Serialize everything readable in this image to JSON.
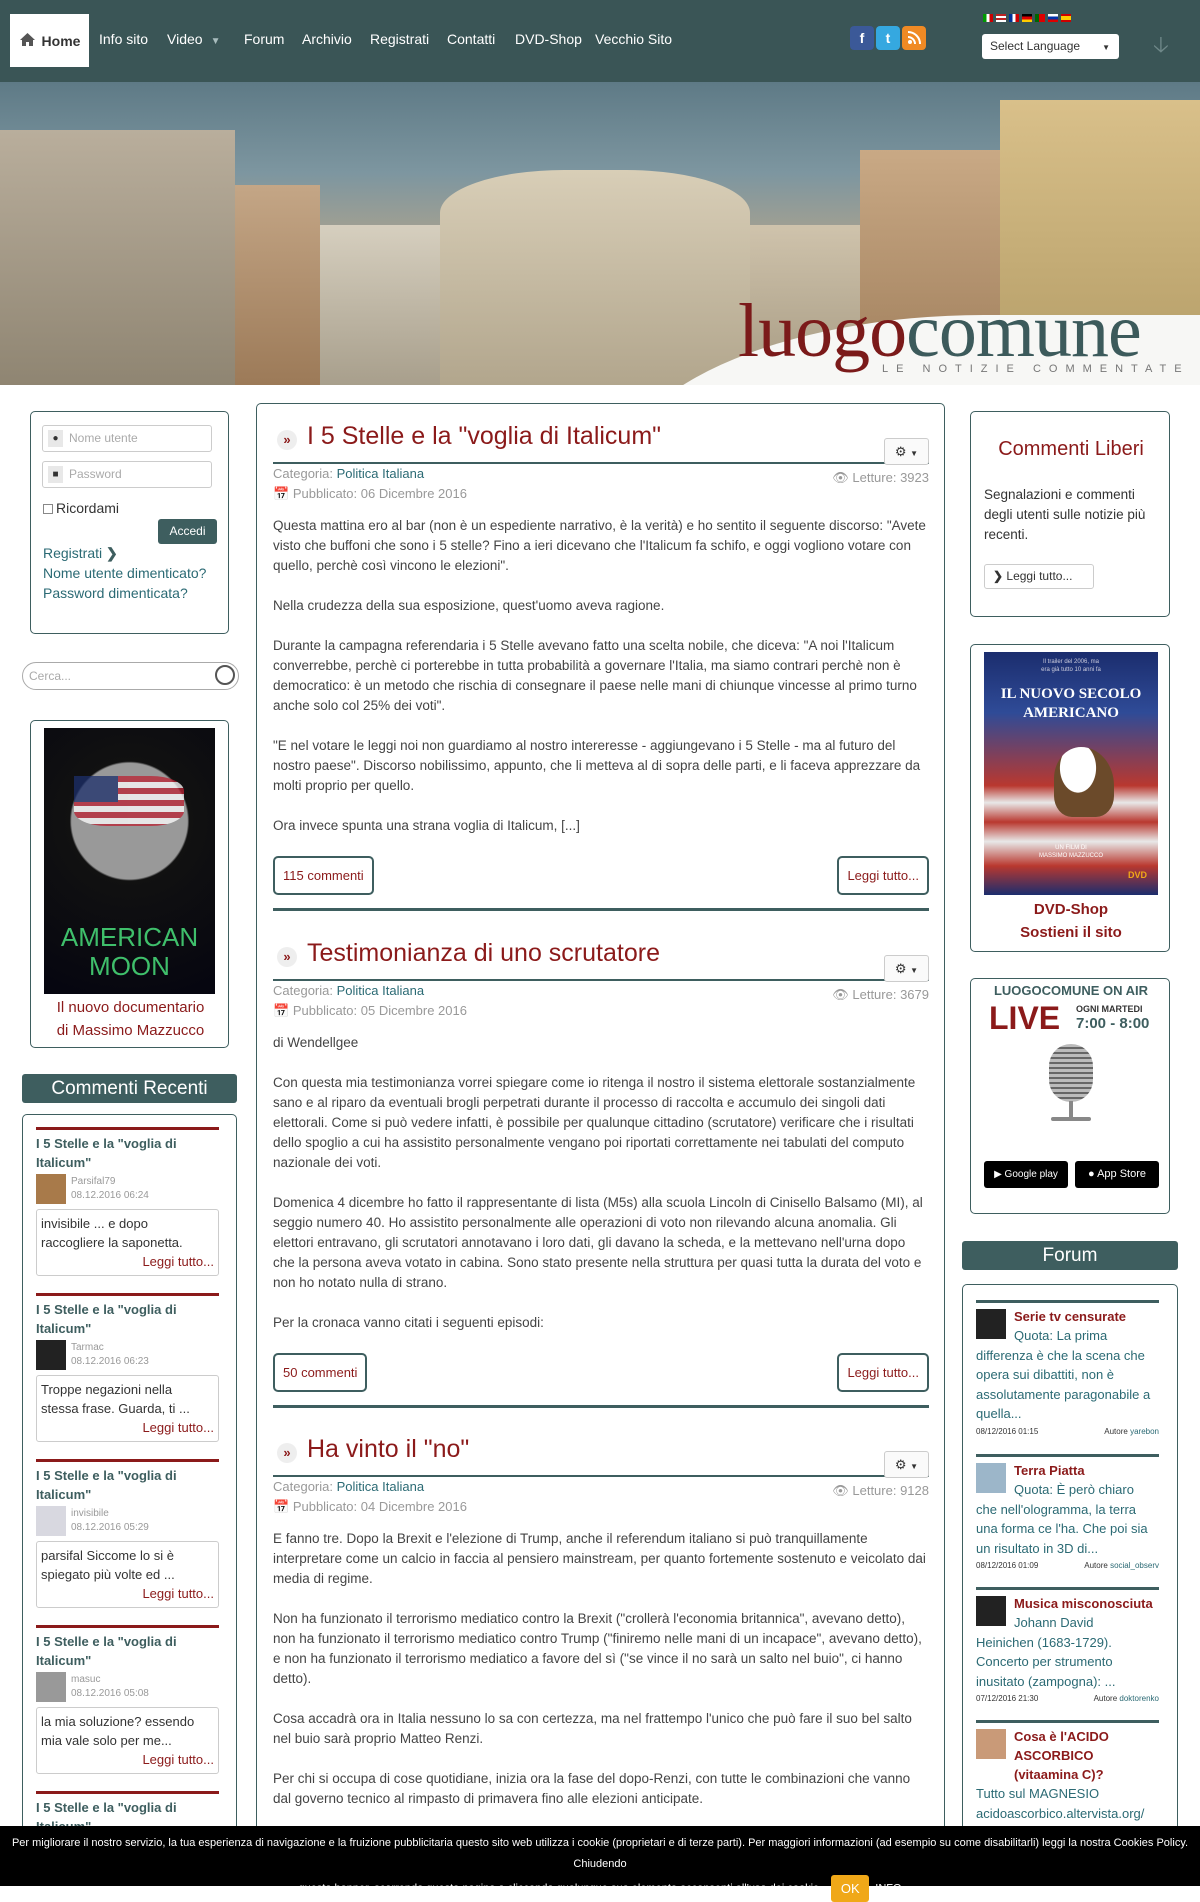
{
  "nav": {
    "home": "Home",
    "items": [
      "Info sito",
      "Video",
      "Forum",
      "Archivio",
      "Registrati",
      "Contatti",
      "DVD-Shop",
      "Vecchio Sito"
    ],
    "social": [
      "f",
      "t",
      "rss"
    ],
    "language_select": "Select Language"
  },
  "hero": {
    "logo_part1": "luogo",
    "logo_part2": "comune",
    "tagline": "LE NOTIZIE COMMENTATE"
  },
  "login": {
    "username_placeholder": "Nome utente",
    "password_placeholder": "Password",
    "remember": "Ricordami",
    "submit": "Accedi",
    "register": "Registrati",
    "forgot_username": "Nome utente dimenticato?",
    "forgot_password": "Password dimenticata?"
  },
  "search": {
    "placeholder": "Cerca..."
  },
  "promo_left": {
    "poster_title_1": "AMERICAN",
    "poster_title_2": "MOON",
    "caption_1": "Il nuovo documentario",
    "caption_2": "di Massimo Mazzucco"
  },
  "recent_comments": {
    "heading": "Commenti Recenti",
    "items": [
      {
        "title_1": "I 5 Stelle e la \"voglia di",
        "title_2": "Italicum\"",
        "user": "Parsifal79",
        "date": "08.12.2016 06:24",
        "text_1": "invisibile ... e dopo",
        "text_2": "raccogliere la saponetta.",
        "more": "Leggi tutto..."
      },
      {
        "title_1": "I 5 Stelle e la \"voglia di",
        "title_2": "Italicum\"",
        "user": "Tarmac",
        "date": "08.12.2016 06:23",
        "text_1": "Troppe negazioni nella",
        "text_2": "stessa frase. Guarda, ti ...",
        "more": "Leggi tutto..."
      },
      {
        "title_1": "I 5 Stelle e la \"voglia di",
        "title_2": "Italicum\"",
        "user": "invisibile",
        "date": "08.12.2016 05:29",
        "text_1": "parsifal Siccome lo si è",
        "text_2": "spiegato più volte ed ...",
        "more": "Leggi tutto..."
      },
      {
        "title_1": "I 5 Stelle e la \"voglia di",
        "title_2": "Italicum\"",
        "user": "masuc",
        "date": "08.12.2016 05:08",
        "text_1": "la mia soluzione? essendo",
        "text_2": "mia vale solo per me...",
        "more": "Leggi tutto..."
      },
      {
        "title_1": "I 5 Stelle e la \"voglia di",
        "title_2": "Italicum\"",
        "user": "",
        "date": "",
        "text_1": "",
        "text_2": "",
        "more": ""
      }
    ]
  },
  "articles": [
    {
      "title": "I 5 Stelle e la \"voglia di Italicum\"",
      "category_label": "Categoria:",
      "category": "Politica Italiana",
      "published": "Pubblicato: 06 Dicembre 2016",
      "reads": "Letture: 3923",
      "paragraphs": [
        "Questa mattina ero al bar (non è un espediente narrativo, è la verità) e ho sentito il seguente discorso: \"Avete visto che buffoni che sono i 5 stelle? Fino a ieri dicevano che l'Italicum fa schifo, e oggi vogliono votare con quello, perchè così vincono le elezioni\".",
        "Nella crudezza della sua esposizione, quest'uomo aveva ragione.",
        "Durante la campagna referendaria i 5 Stelle avevano fatto una scelta nobile, che diceva: \"A noi l'Italicum converrebbe, perchè ci porterebbe in tutta probabilità a governare l'Italia, ma siamo contrari perchè non è democratico: è un metodo che rischia di consegnare il paese nelle mani di chiunque vincesse al primo turno anche solo col 25% dei voti\".",
        "\"E nel votare le leggi noi non guardiamo al nostro intereresse - aggiungevano i 5 Stelle - ma al futuro del nostro paese\". Discorso nobilissimo, appunto, che li metteva al di sopra delle parti, e li faceva apprezzare da molti proprio per quello.",
        "Ora invece spunta una strana voglia di Italicum, [...]"
      ],
      "comments": "115 commenti",
      "more": "Leggi tutto..."
    },
    {
      "title": "Testimonianza di uno scrutatore",
      "category_label": "Categoria:",
      "category": "Politica Italiana",
      "published": "Pubblicato: 05 Dicembre 2016",
      "reads": "Letture: 3679",
      "paragraphs": [
        "di Wendellgee",
        "Con questa mia testimonianza vorrei spiegare come io ritenga il nostro il sistema elettorale sostanzialmente sano e al riparo da eventuali brogli perpetrati durante il processo di raccolta e accumulo dei singoli dati elettorali. Come si può vedere infatti, è possibile per qualunque cittadino (scrutatore) verificare che i risultati dello spoglio a cui ha assistito personalmente vengano poi riportati correttamente nei tabulati del computo nazionale dei voti.",
        "Domenica 4 dicembre ho fatto il rappresentante di lista (M5s) alla scuola Lincoln di Cinisello Balsamo (MI), al seggio numero 40. Ho assistito personalmente alle operazioni di voto non rilevando alcuna anomalia. Gli elettori entravano, gli scrutatori annotavano i loro dati, gli davano la scheda, e la mettevano nell'urna dopo che la persona aveva votato in cabina. Sono stato presente nella struttura per quasi tutta la durata del voto e non ho notato nulla di strano.",
        "Per la cronaca vanno citati i seguenti episodi:"
      ],
      "comments": "50 commenti",
      "more": "Leggi tutto..."
    },
    {
      "title": "Ha vinto il \"no\"",
      "category_label": "Categoria:",
      "category": "Politica Italiana",
      "published": "Pubblicato: 04 Dicembre 2016",
      "reads": "Letture: 9128",
      "paragraphs": [
        "E fanno tre. Dopo la Brexit e l'elezione di Trump, anche il referendum italiano si può tranquillamente interpretare come un calcio in faccia al pensiero mainstream, per quanto fortemente sostenuto e veicolato dai media di regime.",
        "Non ha funzionato il terrorismo mediatico contro la Brexit (\"crollerà l'economia britannica\", avevano detto), non ha funzionato il terrorismo mediatico contro Trump (\"finiremo nelle mani di un incapace\", avevano detto), e non ha funzionato il terrorismo mediatico a favore del sì (\"se vince il no sarà un salto nel buio\", ci hanno detto).",
        "Cosa accadrà ora in Italia nessuno lo sa con certezza, ma nel frattempo l'unico che può fare il suo bel salto nel buio sarà proprio Matteo Renzi.",
        "Per chi si occupa di cose quotidiane, inizia ora la fase del dopo-Renzi, con tutte le combinazioni che vanno dal governo tecnico al rimpasto di primavera fino alle elezioni anticipate."
      ],
      "comments": "",
      "more": ""
    }
  ],
  "commenti_liberi": {
    "title": "Commenti Liberi",
    "text": "Segnalazioni e commenti degli utenti sulle notizie più recenti.",
    "button": "Leggi tutto..."
  },
  "dvd": {
    "poster_top_1": "Il trailer del 2006, ma",
    "poster_top_2": "era già tutto 10 anni fa",
    "poster_title_1": "IL NUOVO SECOLO",
    "poster_title_2": "AMERICANO",
    "poster_credit_1": "UN FILM DI",
    "poster_credit_2": "MASSIMO MAZZUCCO",
    "poster_badge": "DVD",
    "caption_1": "DVD-Shop",
    "caption_2": "Sostieni il sito"
  },
  "onair": {
    "title": "LUOGOCOMUNE ON AIR",
    "live": "LIVE",
    "schedule_1": "OGNI MARTEDI",
    "schedule_2": "7:00 - 8:00",
    "google_play": "Google play",
    "app_store": "App Store"
  },
  "forum": {
    "heading": "Forum",
    "items": [
      {
        "title": "Serie tv censurate",
        "body_1": "Quota: La prima",
        "body_2": "differenza è che la scena che opera sui dibattiti, non è assolutamente paragonabile a quella...",
        "date": "08/12/2016 01:15",
        "author_label": "Autore",
        "author": "yarebon"
      },
      {
        "title": "Terra Piatta",
        "body_1": "Quota: È però chiaro",
        "body_2": "che nell'ologramma, la terra una forma ce l'ha. Che poi sia un risultato in 3D di...",
        "date": "08/12/2016 01:09",
        "author_label": "Autore",
        "author": "social_observ"
      },
      {
        "title": "Musica misconosciuta",
        "body_1": "Johann David",
        "body_2": "Heinichen (1683-1729). Concerto per strumento inusitato (zampogna): ...",
        "date": "07/12/2016 21:30",
        "author_label": "Autore",
        "author": "doktorenko"
      },
      {
        "title": "Cosa è l'ACIDO ASCORBICO (vitaamina C)?",
        "body_1": "Tutto sul MAGNESIO",
        "body_2": "acidoascorbico.altervista.org/",
        "date": "",
        "author_label": "",
        "author": ""
      }
    ]
  },
  "cookie": {
    "text_1": "Per migliorare il nostro servizio, la tua esperienza di navigazione e la fruizione pubblicitaria questo sito web utilizza i cookie (proprietari e di terze parti). Per maggiori informazioni (ad esempio su come disabilitarli) leggi la nostra Cookies Policy. Chiudendo",
    "text_2": "questo banner, scorrendo questa pagina o cliccando qualunque suo elemento acconsenti all'uso dei cookie.",
    "ok": "OK",
    "info": "INFO"
  },
  "colors": {
    "nav_bg": "#3a5556",
    "accent_red": "#8b1a1a",
    "teal": "#3e5e5f",
    "link": "#2b6a74",
    "cookie_ok": "#f0a818"
  }
}
